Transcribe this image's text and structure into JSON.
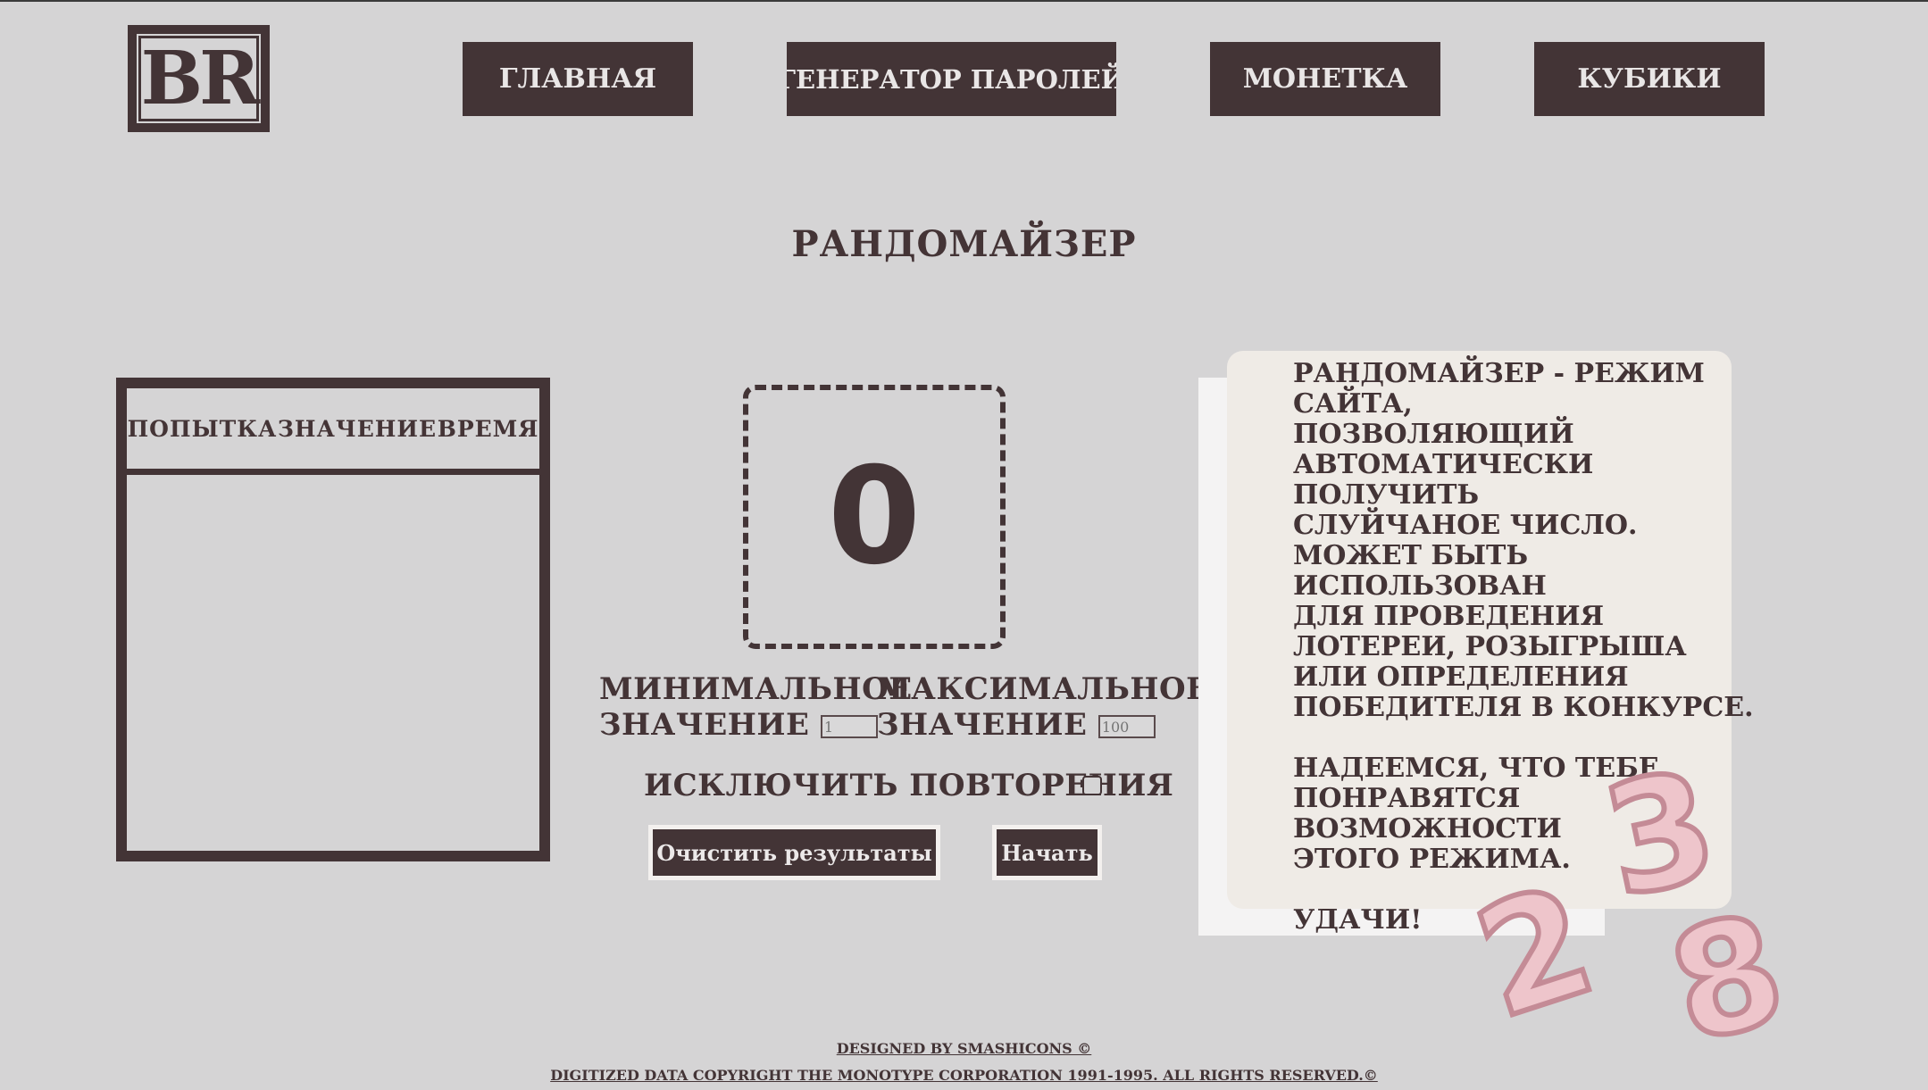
{
  "logo": {
    "text": "BR"
  },
  "nav": {
    "home": "ГЛАВНАЯ",
    "password_generator": "ГЕНЕРАТОР ПАРОЛЕЙ",
    "coin": "МОНЕТКА",
    "dice": "КУБИКИ"
  },
  "page_title": "РАНДОМАЙЗЕР",
  "history": {
    "columns": [
      "ПОПЫТКА",
      "ЗНАЧЕНИЕ",
      "ВРЕМЯ"
    ]
  },
  "result": {
    "value": "0"
  },
  "range": {
    "min_label_line1": "МИНИМАЛЬНОЕ",
    "min_label_line2": "ЗНАЧЕНИЕ",
    "min_placeholder": "1",
    "max_label_line1": "МАКСИМАЛЬНОЕ",
    "max_label_line2": "ЗНАЧЕНИЕ",
    "max_placeholder": "100"
  },
  "exclude_repeats": {
    "label": "ИСКЛЮЧИТЬ ПОВТОРЕНИЯ",
    "checked": false
  },
  "buttons": {
    "clear": "Очистить результаты",
    "start": "Начать"
  },
  "info": {
    "text": "РАНДОМАЙЗЕР - РЕЖИМ\nСАЙТА,\nПОЗВОЛЯЮЩИЙ\nАВТОМАТИЧЕСКИ ПОЛУЧИТЬ\nСЛУЙЧАНОЕ ЧИСЛО.\nМОЖЕТ БЫТЬ ИСПОЛЬЗОВАН\nДЛЯ ПРОВЕДЕНИЯ\nЛОТЕРЕИ, РОЗЫГРЫША\nИЛИ ОПРЕДЕЛЕНИЯ\nПОБЕДИТЕЛЯ В КОНКУРСЕ.\n\nНАДЕЕМСЯ, ЧТО ТЕБЕ\nПОНРАВЯТСЯ ВОЗМОЖНОСТИ\nЭТОГО РЕЖИМА.\n\nУДАЧИ!"
  },
  "decor_digits": [
    "2",
    "3",
    "8"
  ],
  "footer": {
    "line1": "DESIGNED BY SMASHICONS ©",
    "line2": "DIGITIZED DATA COPYRIGHT THE MONOTYPE CORPORATION 1991-1995. ALL RIGHTS RESERVED.©"
  },
  "colors": {
    "primary": "#433436",
    "background": "#d5d4d5",
    "accent_pink": "#eec5cb"
  }
}
